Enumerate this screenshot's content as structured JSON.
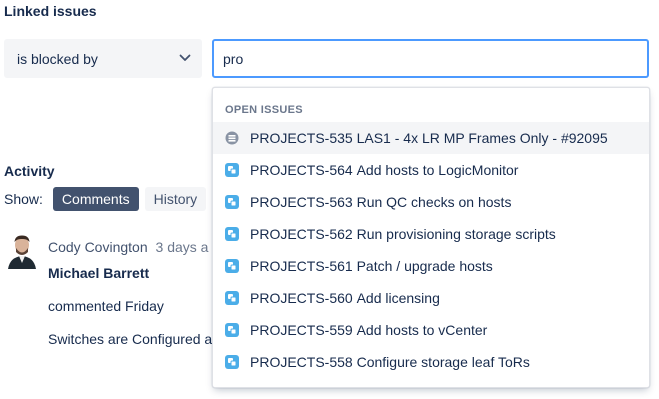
{
  "linked_issues": {
    "title": "Linked issues",
    "relation_select": "is blocked by",
    "search_value": "pro"
  },
  "dropdown": {
    "heading": "OPEN ISSUES",
    "items": [
      {
        "key": "PROJECTS-535",
        "summary": "LAS1 - 4x LR MP Frames Only - #92095",
        "icon": "epic-icon"
      },
      {
        "key": "PROJECTS-564",
        "summary": "Add hosts to LogicMonitor",
        "icon": "task-icon"
      },
      {
        "key": "PROJECTS-563",
        "summary": "Run QC checks on hosts",
        "icon": "task-icon"
      },
      {
        "key": "PROJECTS-562",
        "summary": "Run provisioning storage scripts",
        "icon": "task-icon"
      },
      {
        "key": "PROJECTS-561",
        "summary": "Patch / upgrade hosts",
        "icon": "task-icon"
      },
      {
        "key": "PROJECTS-560",
        "summary": "Add licensing",
        "icon": "task-icon"
      },
      {
        "key": "PROJECTS-559",
        "summary": "Add hosts to vCenter",
        "icon": "task-icon"
      },
      {
        "key": "PROJECTS-558",
        "summary": "Configure storage leaf ToRs",
        "icon": "task-icon"
      }
    ]
  },
  "activity": {
    "title": "Activity",
    "show_label": "Show:",
    "tabs": [
      "Comments",
      "History"
    ],
    "comment": {
      "author": "Cody Covington",
      "time": "3 days a",
      "mention": "Michael Barrett",
      "meta": "commented Friday",
      "body": "Switches are Configured a"
    }
  },
  "colors": {
    "focus_border": "#4c9aff",
    "task_icon": "#4bade8",
    "active_pill": "#42526e"
  }
}
